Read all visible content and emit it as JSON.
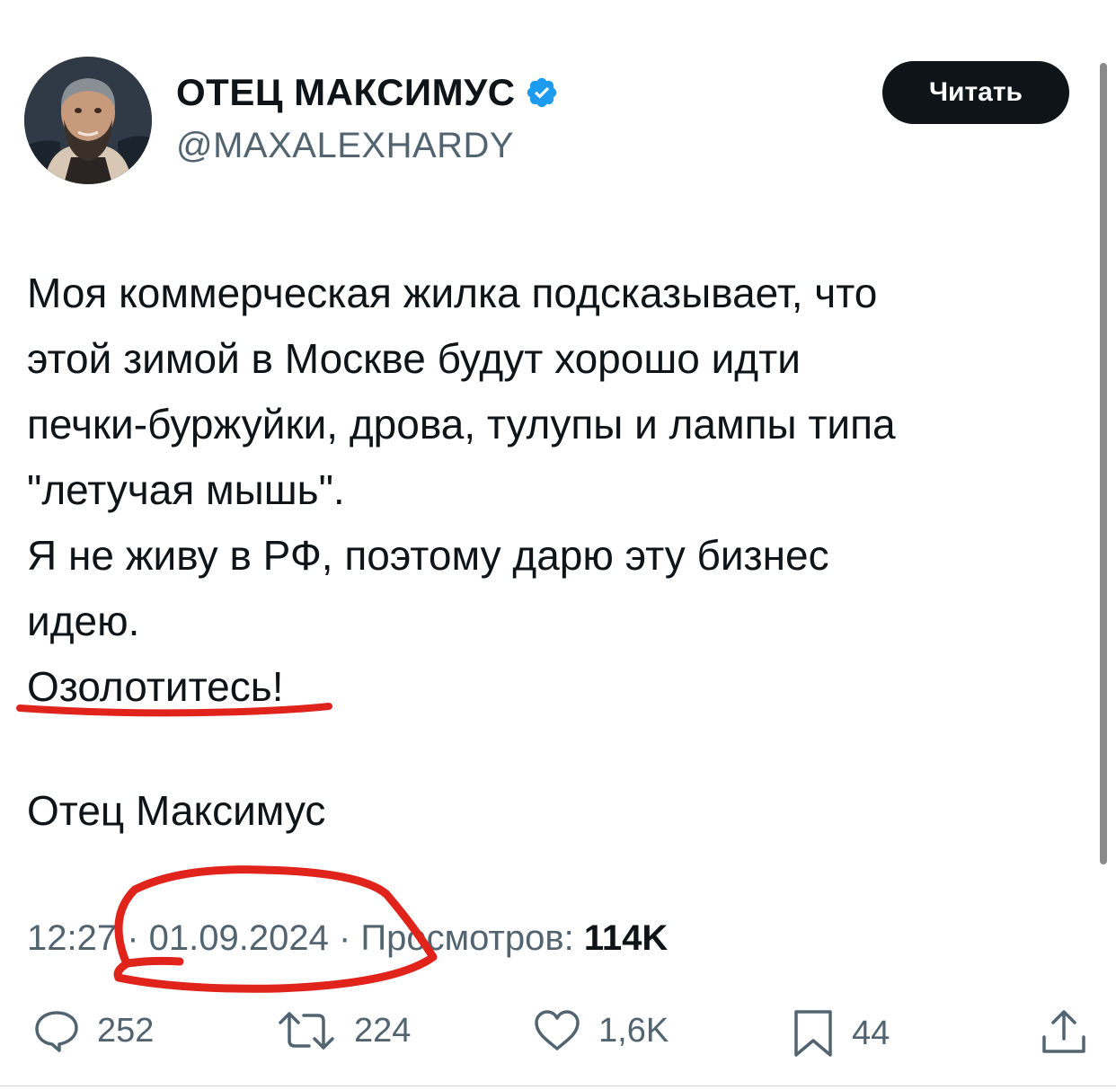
{
  "author": {
    "display_name": "ОТЕЦ МАКСИМУС",
    "handle": "@MAXALEXHARDY",
    "verified_icon": "verified-badge-icon"
  },
  "follow_button": {
    "label": "Читать"
  },
  "tweet": {
    "lines": [
      "Моя коммерческая жилка подсказывает, что",
      "этой зимой в Москве будут хорошо идти",
      "печки-буржуйки, дрова, тулупы и лампы типа",
      "\"летучая мышь\".",
      "Я не живу в РФ, поэтому дарю эту бизнес",
      "идею.",
      "Озолотитесь!"
    ],
    "signature": "Отец Максимус"
  },
  "meta": {
    "time": "12:27",
    "separator": " · ",
    "date": "01.09.2024",
    "views_label": "Просмотров: ",
    "views_count": "114K"
  },
  "actions": {
    "replies": "252",
    "reposts": "224",
    "likes": "1,6K",
    "bookmarks": "44"
  },
  "colors": {
    "text": "#0f1419",
    "secondary": "#536471",
    "verified": "#1d9bf0",
    "annotation": "#e0231b"
  }
}
